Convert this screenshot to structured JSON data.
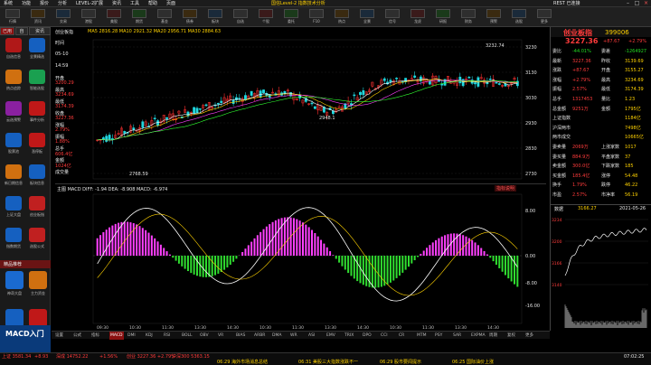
{
  "titlebar": {
    "menu": [
      "系统",
      "功能",
      "报价",
      "分析",
      "LEVEL-2",
      "扩展",
      "资讯",
      "工具",
      "帮助",
      "页面"
    ],
    "center_title": "国信Level-2 指数技术分析",
    "right_status": "REST 已连接"
  },
  "toolbar": {
    "buttons": [
      "行情",
      "资讯",
      "交易",
      "港股",
      "美股",
      "期货",
      "基金",
      "债券",
      "板块",
      "自选",
      "个股",
      "委托",
      "F10",
      "热点",
      "全景",
      "信号",
      "龙虎",
      "研报",
      "财务",
      "预警",
      "选股",
      "更多"
    ]
  },
  "sidebar": {
    "tabs": [
      "已用",
      "自",
      "资讯"
    ],
    "items": [
      "自选信息",
      "全景精选",
      "热点追踪",
      "智能选股",
      "云选预警",
      "事件分析",
      "股票池",
      "涨停板",
      "新日期信息",
      "板块信息",
      "上证大盘",
      "创业板指",
      "指数期货",
      "选股公式"
    ],
    "promo_title": "精品推荐",
    "promo_items": [
      "神奇大盘",
      "主力资金",
      "AI智能指数",
      "特色指标"
    ],
    "banner": "MACD入门"
  },
  "chart": {
    "header_left": "创业板指",
    "ma_line": "MA5 2816.28  MA10 2921.32  MA20 2956.71  MA30 2884.63",
    "side_labels": [
      "时间",
      "05-10",
      "14:59",
      "开盘",
      "最高",
      "最低",
      "收盘",
      "涨幅",
      "振幅",
      "总手",
      "金额",
      "成交量"
    ],
    "side_values": [
      "",
      "",
      "",
      "3200.29",
      "3234.69",
      "3174.39",
      "3227.36",
      "2.79%",
      "1.88%",
      "606.4亿",
      "1024亿",
      ""
    ],
    "price_axis": [
      "3230",
      "3130",
      "3030",
      "2930",
      "2830",
      "2730"
    ],
    "high_label": "3232.74",
    "low_label": "2768.59",
    "mid_label": "2948.1",
    "macd_header": "主图 MACD  DIFF: -1.94  DEA: -8.908  MACD: -6.974",
    "macd_tag": "指标说明",
    "macd_axis": [
      "0.00",
      "8.00",
      "-8.00",
      "-16.00"
    ],
    "time_axis": [
      "09:30",
      "10:30",
      "11:30",
      "13:30",
      "14:30",
      "10:30",
      "11:30",
      "13:30",
      "14:30",
      "10:30",
      "11:30",
      "13:30",
      "14:30"
    ]
  },
  "bottom_tabs": [
    "设置",
    "公式",
    "指标",
    "MACD",
    "DMI",
    "KDJ",
    "RSI",
    "BOLL",
    "OBV",
    "VR",
    "BIAS",
    "ARBR",
    "DMA",
    "WR",
    "ASI",
    "EMV",
    "TRIX",
    "DPO",
    "CCI",
    "CR",
    "MTM",
    "PSY",
    "SAR",
    "EXPMA",
    "周期",
    "复权",
    "更多"
  ],
  "rpanel": {
    "title": "创业板指",
    "code": "399006",
    "price": "3227.36",
    "change": "+87.67",
    "pct": "+2.79%",
    "rows": [
      {
        "l": "委比",
        "v": "-44.01%",
        "l2": "委差",
        "v2": "-1264927"
      },
      {
        "l": "最新",
        "v": "3227.36",
        "l2": "昨收",
        "v2": "3139.69"
      },
      {
        "l": "涨跌",
        "v": "+87.67",
        "l2": "开盘",
        "v2": "3155.27"
      },
      {
        "l": "涨幅",
        "v": "+2.79%",
        "l2": "最高",
        "v2": "3234.69"
      },
      {
        "l": "振幅",
        "v": "2.57%",
        "l2": "最低",
        "v2": "3174.39"
      },
      {
        "l": "总手",
        "v": "1317453",
        "l2": "量比",
        "v2": "1.23"
      },
      {
        "l": "总金额",
        "v": "9251万",
        "l2": "金额",
        "v2": "1795亿"
      },
      {
        "l": "上证指数",
        "v": "",
        "l2": "",
        "v2": "1184亿"
      },
      {
        "l": "沪深两市",
        "v": "",
        "l2": "",
        "v2": "7498亿"
      },
      {
        "l": "两市成交",
        "v": "",
        "l2": "",
        "v2": "10665亿"
      },
      {
        "l": "委卖量",
        "v": "2069万",
        "l2": "上涨家数",
        "v2": "1017"
      },
      {
        "l": "委买量",
        "v": "884.9万",
        "l2": "平盘家数",
        "v2": "37"
      },
      {
        "l": "卖金额",
        "v": "300.0亿",
        "l2": "下跌家数",
        "v2": "185"
      },
      {
        "l": "买金额",
        "v": "185.4亿",
        "l2": "涨停",
        "v2": "54.48"
      },
      {
        "l": "换手",
        "v": "1.79%",
        "l2": "跌停",
        "v2": "46.22"
      },
      {
        "l": "市盈",
        "v": "2.57%",
        "l2": "市净率",
        "v2": "56.19"
      }
    ],
    "mini_header": "数据",
    "mini_value": "3166.27",
    "mini_date": "2021-05-26",
    "mini_axis": [
      "3234",
      "3200",
      "3166",
      "3140"
    ]
  },
  "ticker": [
    {
      "t": "上证 3581.34",
      "c": "red"
    },
    {
      "t": "+8.93",
      "c": "red"
    },
    {
      "t": "深成 14752.22",
      "c": "red"
    },
    {
      "t": "+1.56%",
      "c": "red"
    },
    {
      "t": "创业 3227.36 +2.79%",
      "c": "red"
    },
    {
      "t": "沪深300 5363.15",
      "c": "red"
    },
    {
      "t": "06:29 海外市场消息总结",
      "c": "yellow"
    },
    {
      "t": "06:31 美股三大指数涨跌不一",
      "c": "yellow"
    },
    {
      "t": "06:29 股市要闻提示",
      "c": "yellow"
    },
    {
      "t": "06:25 国际油价上涨",
      "c": "yellow"
    },
    {
      "t": "07:02:25",
      "c": "white"
    }
  ]
}
